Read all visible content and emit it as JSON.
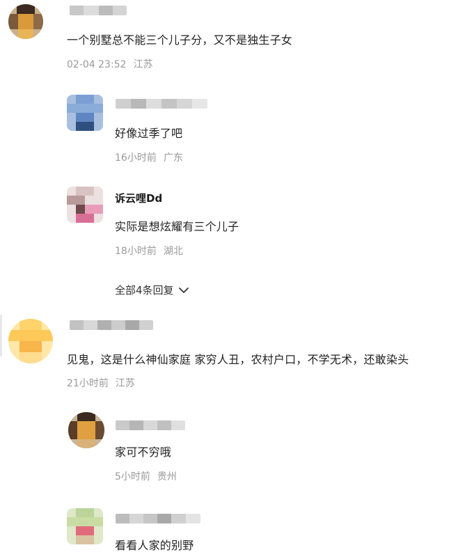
{
  "comments": [
    {
      "text": "一个别墅总不能三个儿子分，又不是独生子女",
      "time": "02-04 23:52",
      "location": "江苏",
      "replies": [
        {
          "text": "好像过季了吧",
          "time": "16小时前",
          "location": "广东"
        },
        {
          "username": "诉云哩Dd",
          "text": "实际是想炫耀有三个儿子",
          "time": "18小时前",
          "location": "湖北"
        }
      ],
      "more_label": "全部4条回复"
    },
    {
      "text": "见鬼，这是什么神仙家庭 家穷人丑，农村户口，不学无术，还敢染头",
      "time": "21小时前",
      "location": "江苏",
      "replies": [
        {
          "text": "家可不穷哦",
          "time": "5小时前",
          "location": "贵州"
        },
        {
          "text": "看看人家的别野"
        }
      ]
    }
  ],
  "icons": {
    "expand": "chevron-down-icon"
  },
  "colors": {
    "meta": "#999999",
    "text": "#222222"
  }
}
